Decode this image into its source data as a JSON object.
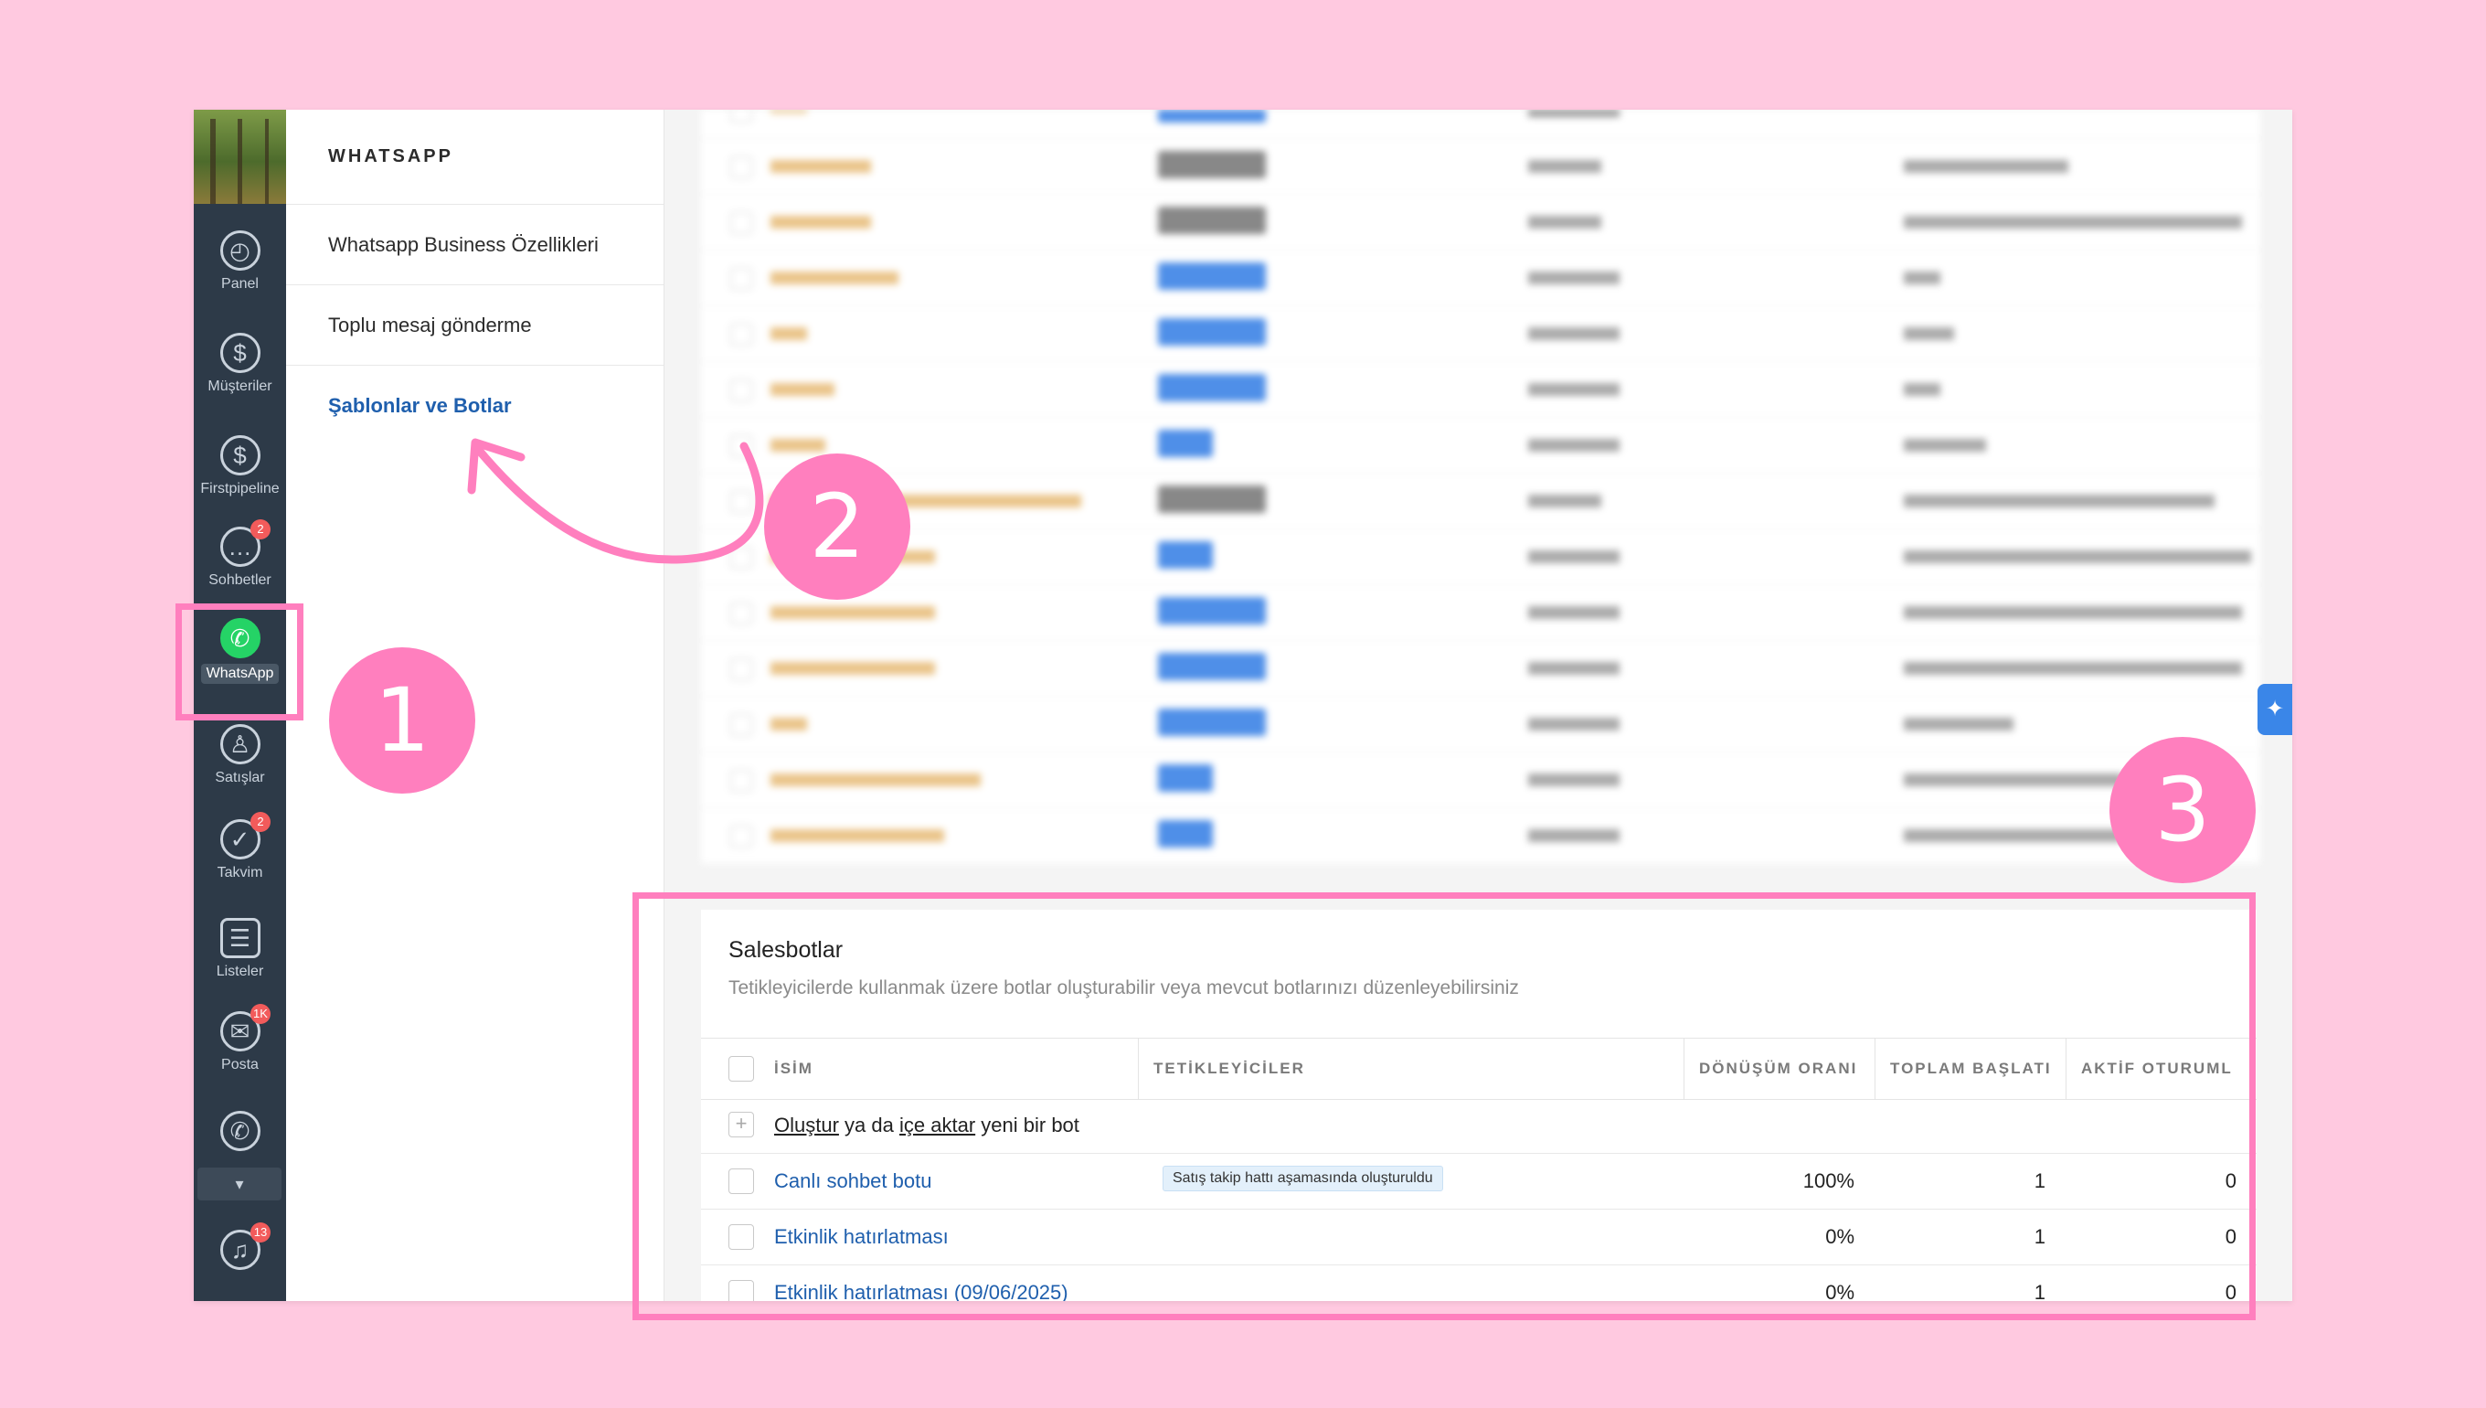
{
  "nav": {
    "items": [
      {
        "label": "Panel",
        "icon": "dashboard-icon",
        "badge": ""
      },
      {
        "label": "Müşteriler",
        "icon": "dollar-icon",
        "badge": ""
      },
      {
        "label": "Firstpipeline",
        "icon": "dollar-icon",
        "badge": ""
      },
      {
        "label": "Sohbetler",
        "icon": "chat-icon",
        "badge": "2"
      },
      {
        "label": "WhatsApp",
        "icon": "whatsapp-icon",
        "badge": ""
      },
      {
        "label": "Satışlar",
        "icon": "sales-icon",
        "badge": ""
      },
      {
        "label": "Takvim",
        "icon": "check-icon",
        "badge": "2"
      },
      {
        "label": "Listeler",
        "icon": "list-icon",
        "badge": ""
      },
      {
        "label": "Posta",
        "icon": "mail-icon",
        "badge": "1K"
      },
      {
        "label": "",
        "icon": "whatsapp-icon",
        "badge": ""
      },
      {
        "label": "",
        "icon": "bell-icon",
        "badge": "13"
      }
    ]
  },
  "subnav": {
    "title": "WHATSAPP",
    "links": [
      "Whatsapp Business Özellikleri",
      "Toplu mesaj gönderme",
      "Şablonlar ve Botlar"
    ]
  },
  "salesbots": {
    "title": "Salesbotlar",
    "subtitle": "Tetikleyicilerde kullanmak üzere botlar oluşturabilir veya mevcut botlarınızı düzenleyebilirsiniz",
    "columns": [
      "İSİM",
      "TETİKLEYİCİLER",
      "DÖNÜŞÜM ORANI",
      "TOPLAM BAŞLATI",
      "AKTİF OTURUML"
    ],
    "create": {
      "create_link": "Oluştur",
      "middle": "ya da",
      "import_link": "içe aktar",
      "suffix": "yeni bir bot"
    },
    "rows": [
      {
        "name": "Canlı sohbet botu",
        "trigger": "Satış takip hattı aşamasında oluşturuldu",
        "rate": "100%",
        "total": "1",
        "active": "0"
      },
      {
        "name": "Etkinlik hatırlatması",
        "trigger": "",
        "rate": "0%",
        "total": "1",
        "active": "0"
      },
      {
        "name": "Etkinlik hatırlatması (09/06/2025)",
        "trigger": "",
        "rate": "0%",
        "total": "1",
        "active": "0"
      }
    ]
  },
  "annotations": [
    "1",
    "2",
    "3"
  ],
  "colors": {
    "accent_pink": "#ff7fbe",
    "link_blue": "#1f5fad",
    "sidebar_dark": "#2d3a48",
    "whatsapp_green": "#25d366"
  }
}
